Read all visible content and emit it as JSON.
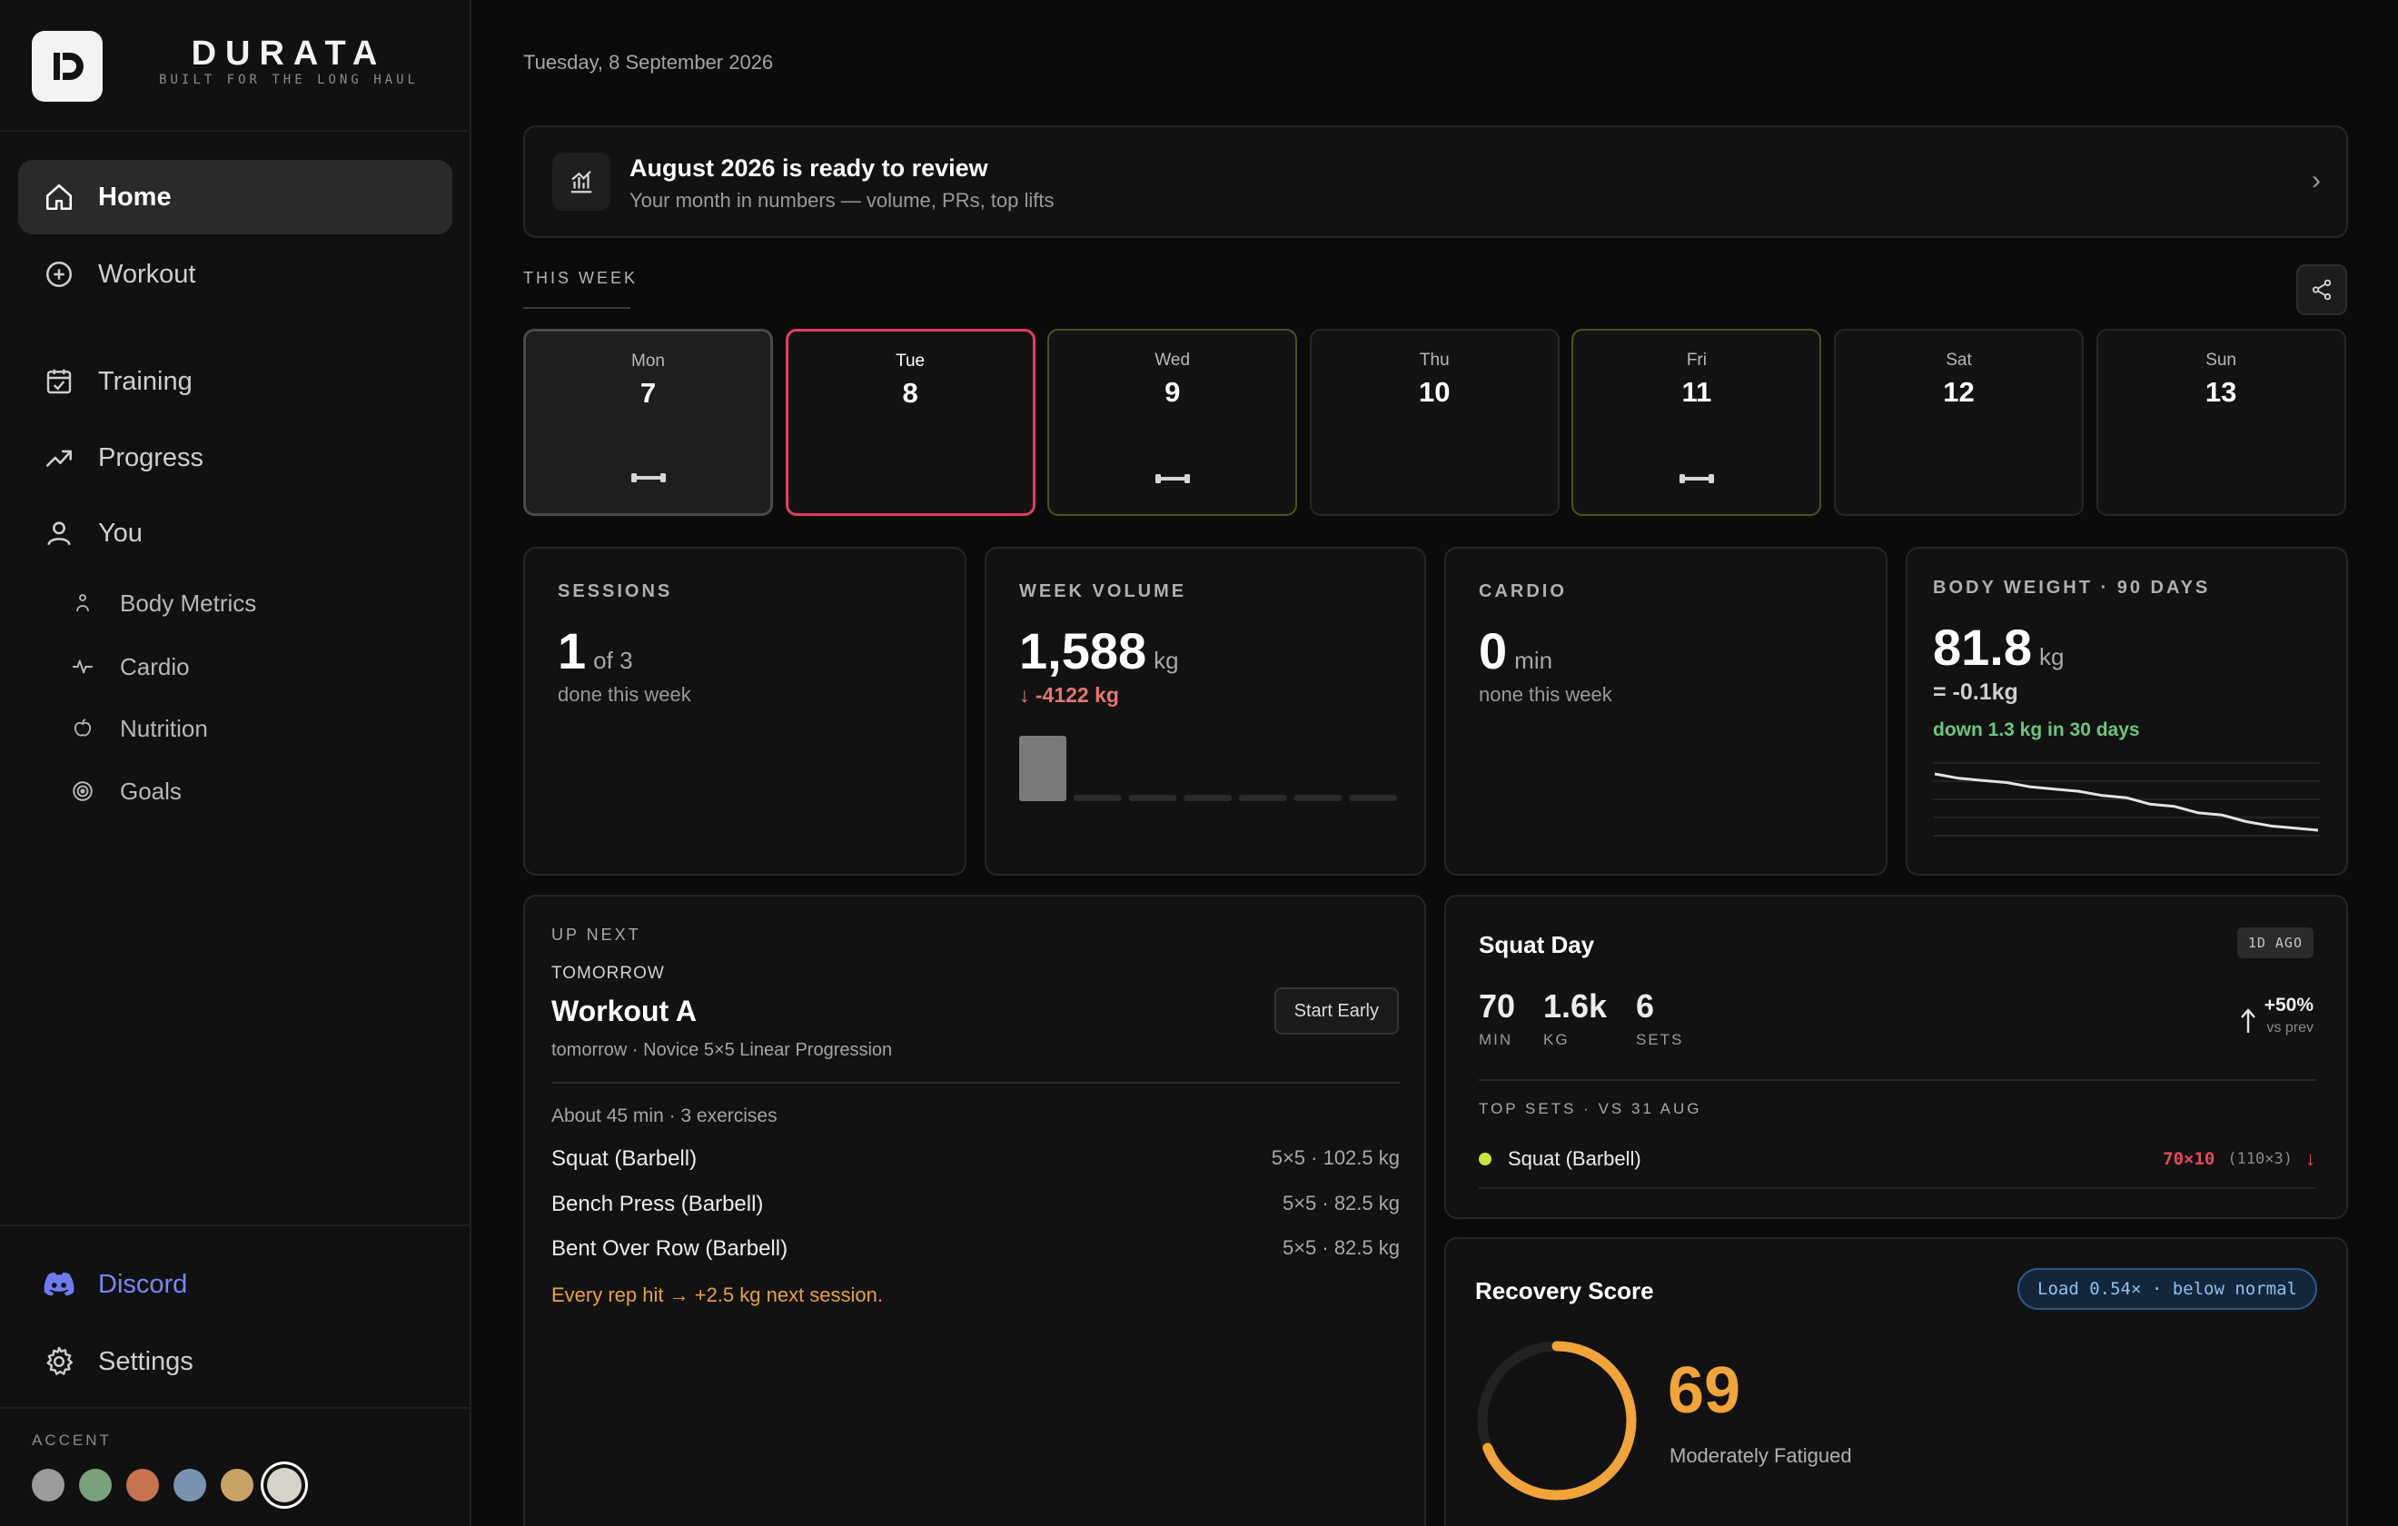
{
  "brand": {
    "name": "DURATA",
    "tagline": "BUILT FOR THE LONG HAUL"
  },
  "nav": {
    "primary": [
      {
        "label": "Home",
        "icon": "home-icon",
        "active": true
      },
      {
        "label": "Workout",
        "icon": "plus-circle-icon"
      }
    ],
    "secondary": [
      {
        "label": "Training",
        "icon": "calendar-check-icon"
      },
      {
        "label": "Progress",
        "icon": "trending-up-icon"
      },
      {
        "label": "You",
        "icon": "user-icon"
      }
    ],
    "sub": [
      {
        "label": "Body Metrics",
        "icon": "person-icon"
      },
      {
        "label": "Cardio",
        "icon": "pulse-icon"
      },
      {
        "label": "Nutrition",
        "icon": "apple-icon"
      },
      {
        "label": "Goals",
        "icon": "target-icon"
      }
    ],
    "bottom": [
      {
        "label": "Discord",
        "icon": "discord-icon"
      },
      {
        "label": "Settings",
        "icon": "gear-icon"
      }
    ]
  },
  "accent": {
    "label": "ACCENT",
    "colors": [
      "#9b9b9b",
      "#7aa07a",
      "#c8734f",
      "#7893b0",
      "#c9a266",
      "#d8d4cc"
    ],
    "selected": 5
  },
  "date": "Tuesday, 8 September 2026",
  "review": {
    "title": "August 2026 is ready to review",
    "subtitle": "Your month in numbers — volume, PRs, top lifts",
    "icon": "chart-icon"
  },
  "week": {
    "label": "THIS WEEK",
    "days": [
      {
        "name": "Mon",
        "date": "7",
        "state": "done",
        "workout": true
      },
      {
        "name": "Tue",
        "date": "8",
        "state": "today",
        "workout": false
      },
      {
        "name": "Wed",
        "date": "9",
        "state": "planned",
        "workout": true
      },
      {
        "name": "Thu",
        "date": "10",
        "state": "rest",
        "workout": false
      },
      {
        "name": "Fri",
        "date": "11",
        "state": "planned",
        "workout": true
      },
      {
        "name": "Sat",
        "date": "12",
        "state": "rest",
        "workout": false
      },
      {
        "name": "Sun",
        "date": "13",
        "state": "rest",
        "workout": false
      }
    ]
  },
  "stats": {
    "sessions": {
      "label": "SESSIONS",
      "value": "1",
      "unit": "of 3",
      "sub": "done this week"
    },
    "volume": {
      "label": "WEEK VOLUME",
      "value": "1,588",
      "unit": "kg",
      "delta": "↓ -4122 kg",
      "bars": [
        1588,
        0,
        0,
        0,
        0,
        0,
        0
      ]
    },
    "cardio": {
      "label": "CARDIO",
      "value": "0",
      "unit": "min",
      "sub": "none this week"
    },
    "weight": {
      "label": "BODY WEIGHT · 90 DAYS",
      "value": "81.8",
      "unit": "kg",
      "delta": "= -0.1kg",
      "trend": "down 1.3 kg in 30 days",
      "series": [
        83.1,
        83.0,
        82.95,
        82.9,
        82.8,
        82.75,
        82.7,
        82.6,
        82.55,
        82.4,
        82.35,
        82.2,
        82.15,
        82.0,
        81.9,
        81.85,
        81.8
      ]
    }
  },
  "upnext": {
    "label": "UP NEXT",
    "when": "TOMORROW",
    "title": "Workout A",
    "subtitle": "tomorrow · Novice 5×5 Linear Progression",
    "start_label": "Start Early",
    "summary": "About 45 min · 3 exercises",
    "exercises": [
      {
        "name": "Squat (Barbell)",
        "spec": "5×5 · 102.5 kg"
      },
      {
        "name": "Bench Press (Barbell)",
        "spec": "5×5 · 82.5 kg"
      },
      {
        "name": "Bent Over Row (Barbell)",
        "spec": "5×5 · 82.5 kg"
      }
    ],
    "note": "Every rep hit → +2.5 kg next session."
  },
  "last_session": {
    "title": "Squat Day",
    "ago": "1D AGO",
    "stats": [
      {
        "value": "70",
        "label": "MIN"
      },
      {
        "value": "1.6k",
        "label": "KG"
      },
      {
        "value": "6",
        "label": "SETS"
      }
    ],
    "change": "+50%",
    "change_sub": "vs prev",
    "top_sets_label": "TOP SETS · VS 31 AUG",
    "top_sets": [
      {
        "name": "Squat (Barbell)",
        "value": "70×10",
        "prev": "(110×3)",
        "arrow": "↓"
      }
    ]
  },
  "recovery": {
    "title": "Recovery Score",
    "load": "Load 0.54× · below normal",
    "score": "69",
    "score_max": 100,
    "status": "Moderately Fatigued"
  }
}
